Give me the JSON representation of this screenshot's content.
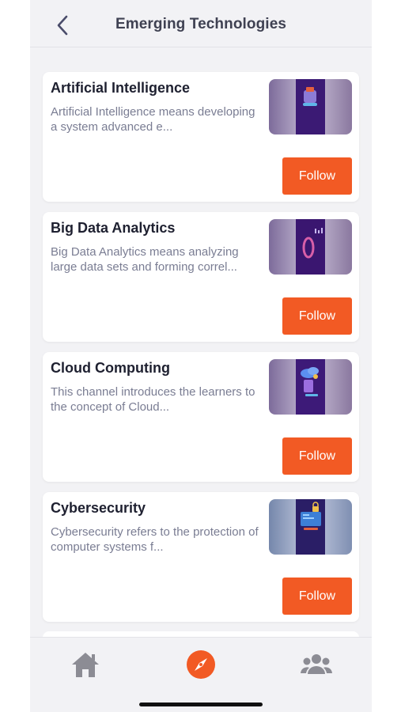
{
  "header": {
    "title": "Emerging Technologies",
    "back_icon": "chevron-left-icon"
  },
  "channels": [
    {
      "title": "Artificial Intelligence",
      "description": "Artificial Intelligence means developing a system advanced e...",
      "button_label": "Follow",
      "thumbnail_icon": "ai-chip-icon"
    },
    {
      "title": "Big Data Analytics",
      "description": "Big Data Analytics means analyzing large data sets and forming correl...",
      "button_label": "Follow",
      "thumbnail_icon": "data-ring-icon"
    },
    {
      "title": "Cloud Computing",
      "description": "This channel introduces the learners to the concept of Cloud...",
      "button_label": "Follow",
      "thumbnail_icon": "cloud-icon"
    },
    {
      "title": "Cybersecurity",
      "description": "Cybersecurity refers to the protection of computer systems f...",
      "button_label": "Follow",
      "thumbnail_icon": "lock-screen-icon"
    }
  ],
  "tabbar": {
    "items": [
      {
        "name": "home",
        "icon": "home-icon",
        "active": false
      },
      {
        "name": "explore",
        "icon": "compass-icon",
        "active": true
      },
      {
        "name": "community",
        "icon": "people-icon",
        "active": false
      }
    ]
  },
  "colors": {
    "accent": "#f25a24",
    "background": "#f2f2f5",
    "title_text": "#1e2030",
    "description_text": "#7a7d93",
    "inactive_icon": "#8c8c94"
  }
}
